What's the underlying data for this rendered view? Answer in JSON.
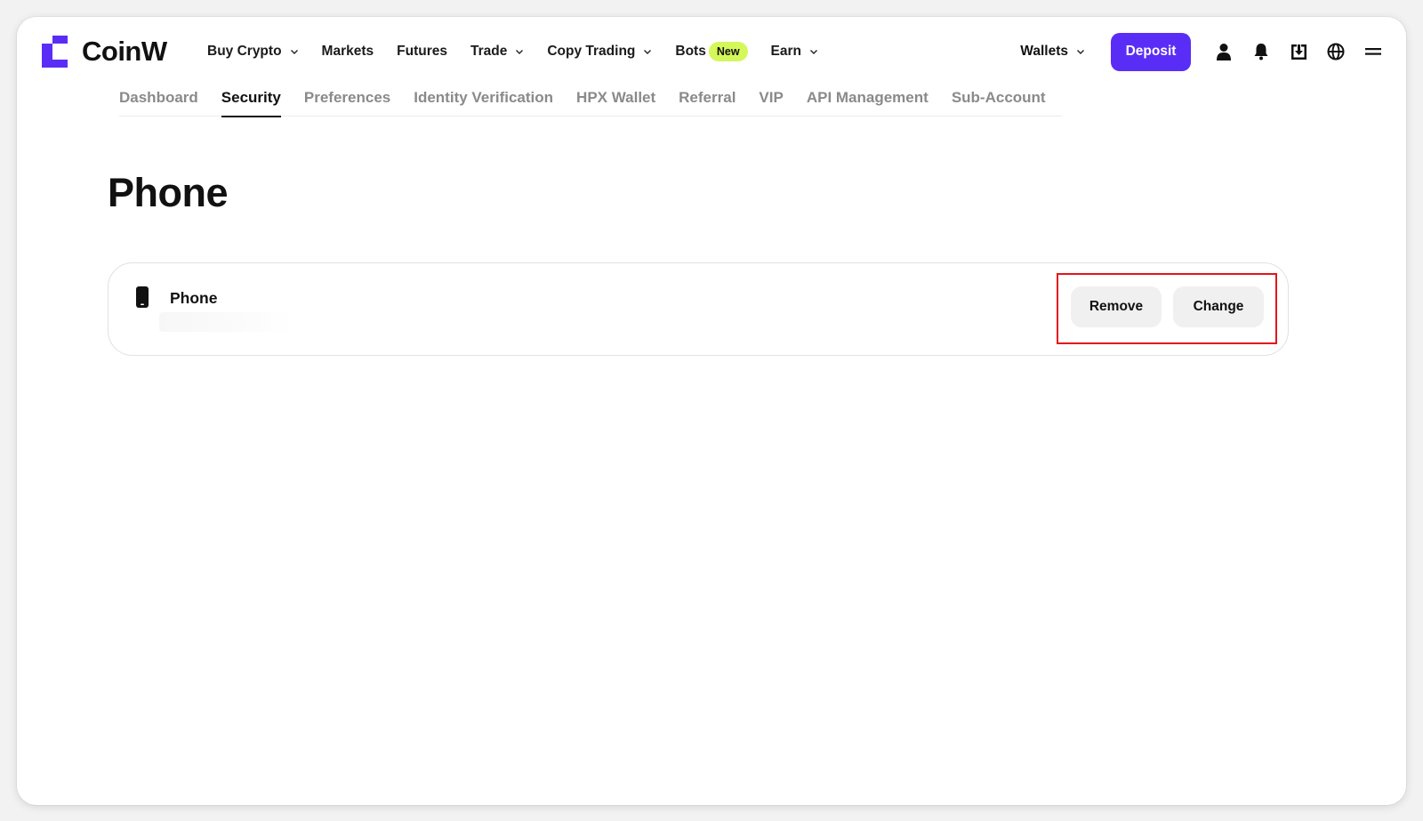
{
  "brand": {
    "name": "CoinW",
    "accent": "#5a2df6",
    "new_badge_color": "#d4f75a"
  },
  "nav": {
    "items": [
      {
        "label": "Buy Crypto",
        "dropdown": true
      },
      {
        "label": "Markets",
        "dropdown": false
      },
      {
        "label": "Futures",
        "dropdown": false
      },
      {
        "label": "Trade",
        "dropdown": true
      },
      {
        "label": "Copy Trading",
        "dropdown": true
      },
      {
        "label": "Bots",
        "dropdown": false,
        "badge": "New"
      },
      {
        "label": "Earn",
        "dropdown": true
      }
    ],
    "wallets_label": "Wallets",
    "deposit_label": "Deposit",
    "icons": [
      "user-icon",
      "bell-icon",
      "download-icon",
      "globe-icon",
      "menu-icon"
    ]
  },
  "subtabs": [
    {
      "label": "Dashboard",
      "active": false
    },
    {
      "label": "Security",
      "active": true
    },
    {
      "label": "Preferences",
      "active": false
    },
    {
      "label": "Identity Verification",
      "active": false
    },
    {
      "label": "HPX Wallet",
      "active": false
    },
    {
      "label": "Referral",
      "active": false
    },
    {
      "label": "VIP",
      "active": false
    },
    {
      "label": "API Management",
      "active": false
    },
    {
      "label": "Sub-Account",
      "active": false
    }
  ],
  "page": {
    "title": "Phone",
    "card": {
      "label": "Phone",
      "icon": "phone-icon",
      "remove_label": "Remove",
      "change_label": "Change",
      "highlight_color": "#e3151a"
    }
  }
}
